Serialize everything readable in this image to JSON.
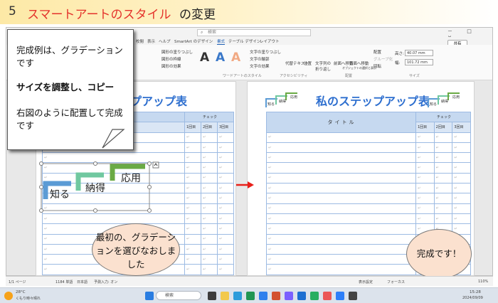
{
  "header": {
    "number": "5",
    "title_red": "スマートアートのスタイル",
    "title_black": "の変更"
  },
  "word": {
    "search_placeholder": "検索",
    "window_controls": "－ □ ✕",
    "tabs": [
      "校閲",
      "表示",
      "ヘルプ",
      "SmartArt のデザイン",
      "書式",
      "テーブル デザイン",
      "レイアウト"
    ],
    "active_tab": "書式",
    "share_label": "共有",
    "ribbon": {
      "shape_items": [
        "図形の塗りつぶし",
        "図形の枠線",
        "図形の効果"
      ],
      "text_items": [
        "文字の塗りつぶし",
        "文字の輪郭",
        "文字の効果"
      ],
      "alt_text": "代替テキスト",
      "arrange_items": [
        "位置",
        "文字列の折り返し",
        "前面へ移動",
        "背面へ移動",
        "オブジェクトの選択と表示"
      ],
      "group_items": [
        "配置",
        "グループ化",
        "回転"
      ],
      "height_label": "高さ:",
      "height_value": "40.07 mm",
      "width_label": "幅:",
      "width_value": "101.72 mm",
      "groups": [
        "ワードアートのスタイル",
        "アクセシビリティ",
        "配置",
        "サイズ"
      ]
    }
  },
  "doc_left": {
    "title": "プアップ表",
    "check_header": "チェック",
    "round_headers": [
      "1回目",
      "2回目",
      "3回目"
    ]
  },
  "doc_right": {
    "title": "私のステップアップ表",
    "title_header": "タイトル",
    "check_header": "チェック",
    "round_headers": [
      "1回目",
      "2回目",
      "3回目"
    ],
    "mini_steps": [
      "知る",
      "納得",
      "応用"
    ]
  },
  "smartart": {
    "steps": [
      "知る",
      "納得",
      "応用"
    ],
    "colors": [
      "#5b9bd5",
      "#70c8a0",
      "#6aaa44"
    ]
  },
  "note_box": {
    "lines": [
      "完成例は、グラデーションです",
      "サイズを調整し、コピー",
      "右図のように配置して完成です"
    ],
    "bold_words": [
      "サイズを調整",
      "コピー",
      "配置"
    ]
  },
  "bubbles": {
    "left": "最初の、グラデーションを選びなおしました",
    "right": "完成です！"
  },
  "statusbar": {
    "page": "1/1 ページ",
    "words": "1184 単語",
    "lang": "日本語",
    "mode": "予測入力: オン",
    "focus": "フォーカス",
    "display": "表示設定",
    "zoom": "110%"
  },
  "taskbar": {
    "weather_temp": "28°C",
    "weather_desc": "くもり時々晴れ",
    "search": "検索",
    "time": "15:28",
    "date": "2024/09/09"
  },
  "colors": {
    "red_text": "#e4322b",
    "blue_title": "#2e6fcf",
    "bubble_fill": "#fbe1cf",
    "arrow": "#e8201a"
  }
}
